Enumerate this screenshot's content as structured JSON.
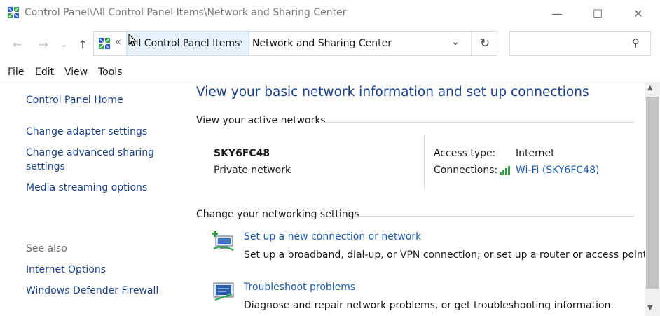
{
  "window": {
    "title": "Control Panel\\All Control Panel Items\\Network and Sharing Center",
    "minimize_glyph": "—",
    "maximize_glyph": "☐",
    "close_glyph": "✕"
  },
  "navbar": {
    "back_glyph": "←",
    "forward_glyph": "→",
    "recent_glyph": "⌄",
    "up_glyph": "↑",
    "overflow_glyph": "«",
    "breadcrumbs": [
      "All Control Panel Items",
      "Network and Sharing Center"
    ],
    "separator_glyph": "›",
    "dropdown_glyph": "⌄",
    "refresh_glyph": "↻",
    "search_placeholder": "",
    "search_glyph": "⚲"
  },
  "menu": [
    "File",
    "Edit",
    "View",
    "Tools"
  ],
  "left_pane": {
    "links": [
      "Control Panel Home",
      "Change adapter settings",
      "Change advanced sharing settings",
      "Media streaming options"
    ],
    "advanced_line1": "Change advanced sharing",
    "advanced_line2": "settings",
    "see_also_title": "See also",
    "see_also": [
      "Internet Options",
      "Windows Defender Firewall"
    ]
  },
  "main": {
    "heading": "View your basic network information and set up connections",
    "active_networks_title": "View your active networks",
    "network": {
      "name": "SKY6FC48",
      "category": "Private network",
      "access_type_label": "Access type:",
      "access_type_value": "Internet",
      "connections_label": "Connections:",
      "connection_value": "Wi-Fi (SKY6FC48)"
    },
    "change_settings_title": "Change your networking settings",
    "tasks": [
      {
        "title": "Set up a new connection or network",
        "description": "Set up a broadband, dial-up, or VPN connection; or set up a router or access point.",
        "icon": "new-connection-icon"
      },
      {
        "title": "Troubleshoot problems",
        "description": "Diagnose and repair network problems, or get troubleshooting information.",
        "icon": "troubleshoot-icon"
      }
    ]
  },
  "colors": {
    "link": "#1a5aaa",
    "heading": "#1a3f86",
    "breadcrumb_highlight": "#e5f1fb",
    "scrollbar_thumb": "#c2c2c2"
  }
}
